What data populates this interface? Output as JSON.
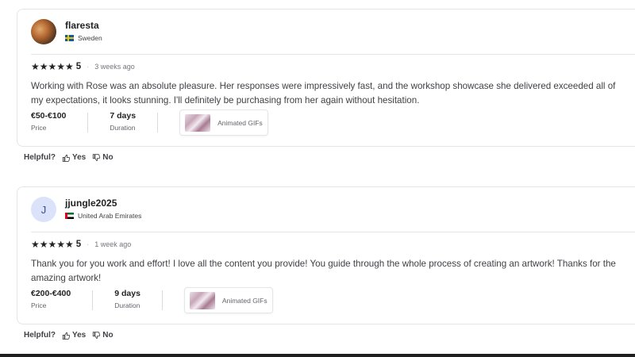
{
  "reviews": [
    {
      "username": "flaresta",
      "avatar": "photo",
      "country": "Sweden",
      "stars": "★★★★★",
      "rating": "5",
      "time": "3 weeks ago",
      "text": "Working with Rose was an absolute pleasure. Her responses were impressively fast, and the workshop showcase she delivered exceeded all of my expectations, it looks stunning. I'll definitely be purchasing from her again without hesitation.",
      "price": "€50-€100",
      "price_label": "Price",
      "duration": "7 days",
      "duration_label": "Duration",
      "tag": "Animated GIFs"
    },
    {
      "username": "jjungle2025",
      "avatar_letter": "J",
      "country": "United Arab Emirates",
      "stars": "★★★★★",
      "rating": "5",
      "time": "1 week ago",
      "text": "Thank you for you work and effort! I love all the content you provide! You guide through the whole process of creating an artwork! Thanks for the amazing artwork!",
      "price": "€200-€400",
      "price_label": "Price",
      "duration": "9 days",
      "duration_label": "Duration",
      "tag": "Animated GIFs"
    }
  ],
  "helpful": {
    "label": "Helpful?",
    "yes": "Yes",
    "no": "No"
  },
  "icons": {
    "thumbs_up": "thumbs-up-icon",
    "thumbs_down": "thumbs-down-icon",
    "star": "star-icon"
  }
}
